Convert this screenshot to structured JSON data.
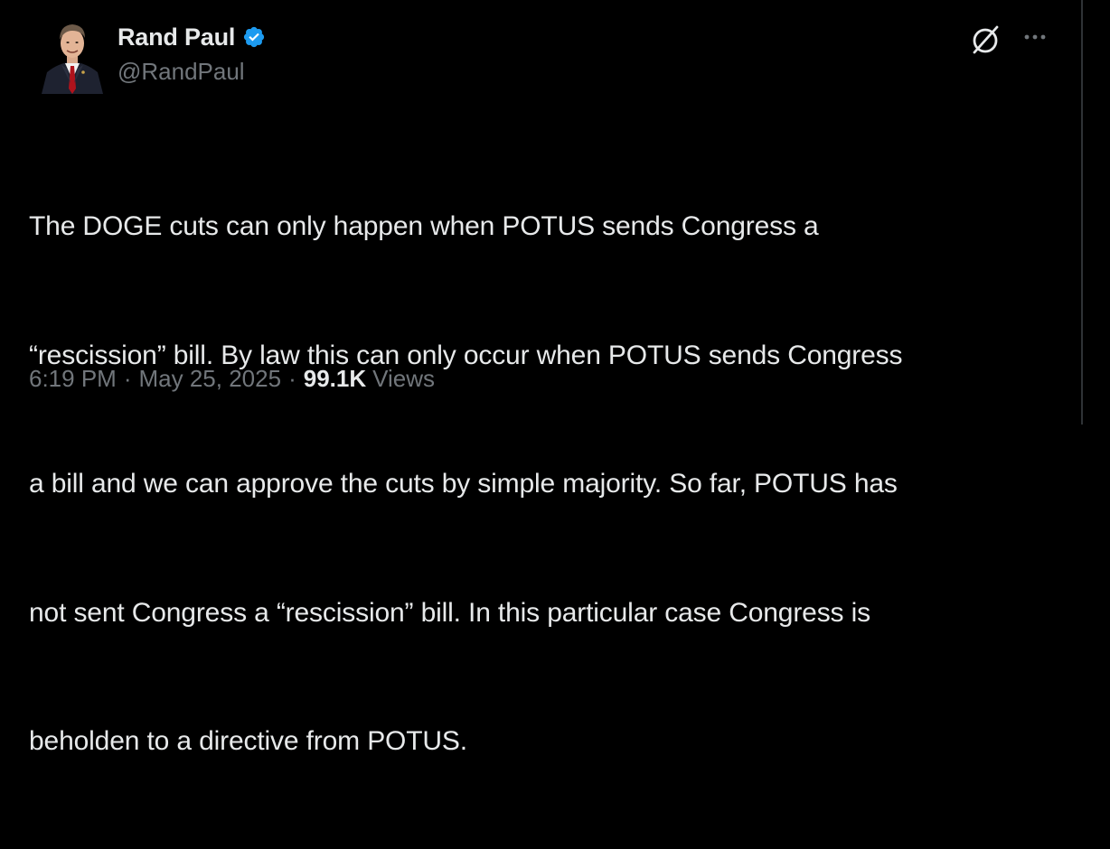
{
  "author": {
    "display_name": "Rand Paul",
    "handle": "@RandPaul",
    "verified_badge_color": "#1d9bf0"
  },
  "header_actions": {
    "grok_icon": "grok-slash-circle-icon",
    "more_icon": "ellipsis-icon"
  },
  "tweet": {
    "text_lines": [
      "The DOGE cuts can only happen when POTUS sends Congress a",
      "“rescission” bill. By law this can only occur when POTUS sends Congress",
      "a bill and we can approve the cuts by simple majority. So far, POTUS has",
      "not sent Congress a “rescission” bill. In this particular case Congress is",
      "beholden to a directive from POTUS."
    ]
  },
  "meta": {
    "time": "6:19 PM",
    "separator": "·",
    "date": "May 25, 2025",
    "views_count": "99.1K",
    "views_label": "Views"
  },
  "colors": {
    "background": "#000000",
    "text_primary": "#e7e9ea",
    "text_secondary": "#71767b",
    "border": "#2f3336"
  }
}
